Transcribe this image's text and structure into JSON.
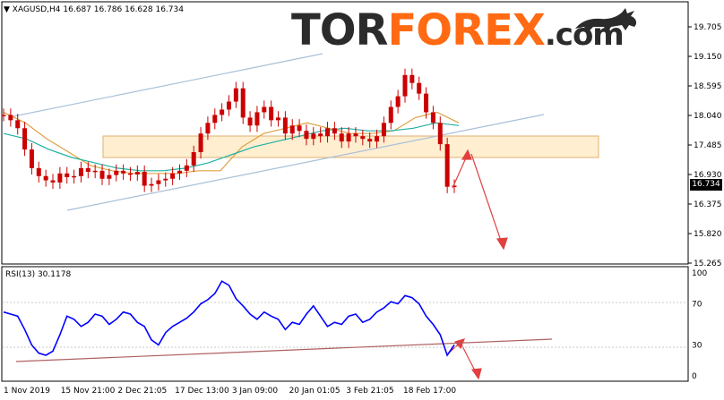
{
  "header": {
    "symbol": "XAGUSD,H4",
    "ohlc": "16.687 16.786 16.628 16.734"
  },
  "logo": {
    "part1": "TOR",
    "part2": "FOREX",
    "part3": ".com"
  },
  "current_price": "16.734",
  "rsi_header": "RSI(13) 30.1178",
  "colors": {
    "candles": "#cc0000",
    "ma_fast": "#e0a040",
    "ma_slow": "#20b0a0",
    "channel": "#a8c0d8",
    "zone": "#ffe9c0",
    "forecast": "#e04040",
    "rsi": "#0000ff",
    "rsi_trend": "#b06060"
  },
  "chart_data": [
    {
      "type": "line",
      "title": "XAGUSD,H4",
      "x_tick_labels": [
        "1 Nov 2019",
        "15 Nov 21:00",
        "2 Dec 21:05",
        "17 Dec 13:00",
        "3 Jan 09:00",
        "20 Jan 01:05",
        "3 Feb 21:05",
        "18 Feb 17:00"
      ],
      "y_tick_labels": [
        "19.705",
        "19.150",
        "18.595",
        "18.040",
        "17.485",
        "16.930",
        "16.375",
        "15.820",
        "15.265"
      ],
      "ylim": [
        15.265,
        19.705
      ],
      "series": [
        {
          "values": [
            18.05,
            17.95,
            17.8,
            17.4,
            17.05,
            16.9,
            16.82,
            16.78,
            16.95,
            16.88,
            16.9,
            17.05,
            16.98,
            17.0,
            16.85,
            16.92,
            17.0,
            16.95,
            16.93,
            16.98,
            16.72,
            16.75,
            16.82,
            16.85,
            16.95,
            17.0,
            17.1,
            17.35,
            17.7,
            17.9,
            18.05,
            18.15,
            18.3,
            18.55,
            18.0,
            17.85,
            18.1,
            18.2,
            17.95,
            18.0,
            17.7,
            17.85,
            17.75,
            17.6,
            17.7,
            17.65,
            17.8,
            17.7,
            17.55,
            17.7,
            17.65,
            17.6,
            17.55,
            17.65,
            17.9,
            18.2,
            18.4,
            18.8,
            18.65,
            18.45,
            18.1,
            17.9,
            17.5,
            16.7,
            16.72
          ]
        },
        {
          "values": [
            18.1,
            17.9,
            17.6,
            17.35,
            17.1,
            17.0,
            16.95,
            16.95,
            16.95,
            17.0,
            17.0,
            17.45,
            17.7,
            17.8,
            17.9,
            17.8,
            17.7,
            17.7,
            17.75,
            18.0,
            18.1,
            17.9
          ]
        },
        {
          "values": [
            17.7,
            17.6,
            17.4,
            17.25,
            17.15,
            17.05,
            17.0,
            17.0,
            17.05,
            17.15,
            17.3,
            17.45,
            17.55,
            17.65,
            17.75,
            17.8,
            17.75,
            17.75,
            17.8,
            17.9,
            17.85
          ]
        }
      ]
    },
    {
      "type": "line",
      "title": "RSI(13) 30.1178",
      "y_tick_labels": [
        "100",
        "70",
        "30",
        "0"
      ],
      "ylim": [
        0,
        100
      ],
      "series": [
        {
          "values": [
            62,
            60,
            58,
            45,
            30,
            22,
            20,
            24,
            40,
            58,
            55,
            48,
            52,
            60,
            58,
            50,
            55,
            62,
            60,
            52,
            48,
            35,
            30,
            42,
            48,
            52,
            56,
            62,
            70,
            74,
            80,
            92,
            88,
            75,
            68,
            60,
            55,
            62,
            58,
            55,
            45,
            52,
            50,
            60,
            68,
            58,
            48,
            52,
            50,
            58,
            60,
            52,
            55,
            62,
            66,
            72,
            70,
            78,
            76,
            70,
            58,
            50,
            40,
            20,
            30
          ]
        }
      ]
    }
  ]
}
